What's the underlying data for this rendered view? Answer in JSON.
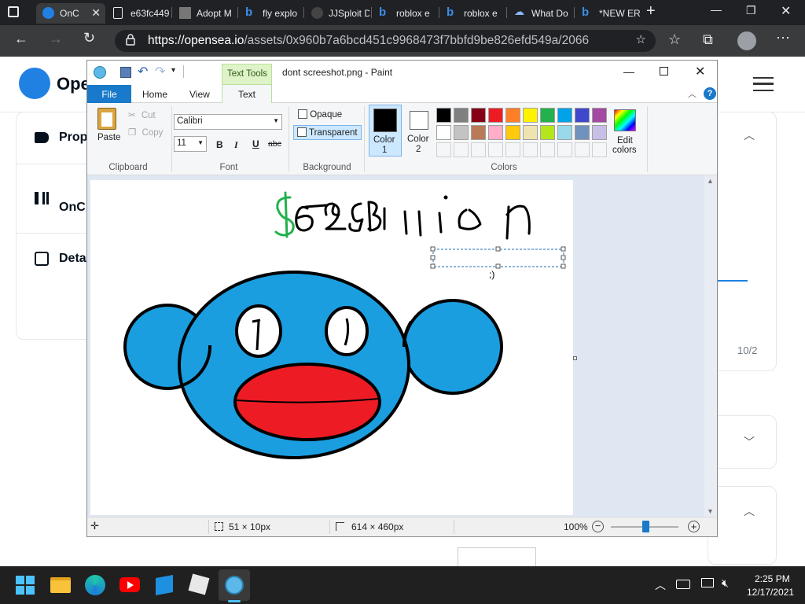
{
  "browser": {
    "tabs": [
      {
        "title": "OnC",
        "active": true
      },
      {
        "title": "e63fc449"
      },
      {
        "title": "Adopt M"
      },
      {
        "title": "fly explo"
      },
      {
        "title": "JJSploit D"
      },
      {
        "title": "roblox e"
      },
      {
        "title": "roblox e"
      },
      {
        "title": "What Do"
      },
      {
        "title": "*NEW ER"
      }
    ],
    "url_host": "https://opensea.io",
    "url_path": "/assets/0x960b7a6bcd451c9968473f7bbfd9be826efd549a/2066"
  },
  "opensea": {
    "logo_text": "Ope",
    "side_items": [
      "Prop",
      "OnC",
      "Deta"
    ],
    "page_fragment": "10/2"
  },
  "paint": {
    "title": "dont screeshot.png - Paint",
    "context_tab": "Text Tools",
    "tabs": [
      "File",
      "Home",
      "View",
      "Text"
    ],
    "clipboard": {
      "paste": "Paste",
      "cut": "Cut",
      "copy": "Copy",
      "label": "Clipboard"
    },
    "font": {
      "family": "Calibri",
      "size": "11",
      "label": "Font",
      "bold": "B",
      "italic": "I",
      "underline": "U",
      "strike": "abc"
    },
    "background": {
      "opaque": "Opaque",
      "transparent": "Transparent",
      "label": "Background"
    },
    "colors": {
      "color1_label": "Color",
      "color1_num": "1",
      "color2_label": "Color",
      "color2_num": "2",
      "edit_label1": "Edit",
      "edit_label2": "colors",
      "label": "Colors",
      "palette_row1": [
        "#000000",
        "#7f7f7f",
        "#880015",
        "#ed1c24",
        "#ff7f27",
        "#fff200",
        "#22b14c",
        "#00a2e8",
        "#3f48cc",
        "#a349a4"
      ],
      "palette_row2": [
        "#ffffff",
        "#c3c3c3",
        "#b97a57",
        "#ffaec9",
        "#ffc90e",
        "#efe4b0",
        "#b5e61d",
        "#99d9ea",
        "#7092be",
        "#c8bfe7"
      ]
    },
    "canvas": {
      "drawing_text": "$69Billian",
      "textbox_text": ";)"
    },
    "status": {
      "selection": "51 × 10px",
      "image_size": "614 × 460px",
      "zoom": "100%"
    }
  },
  "taskbar": {
    "time": "2:25 PM",
    "date": "12/17/2021"
  }
}
